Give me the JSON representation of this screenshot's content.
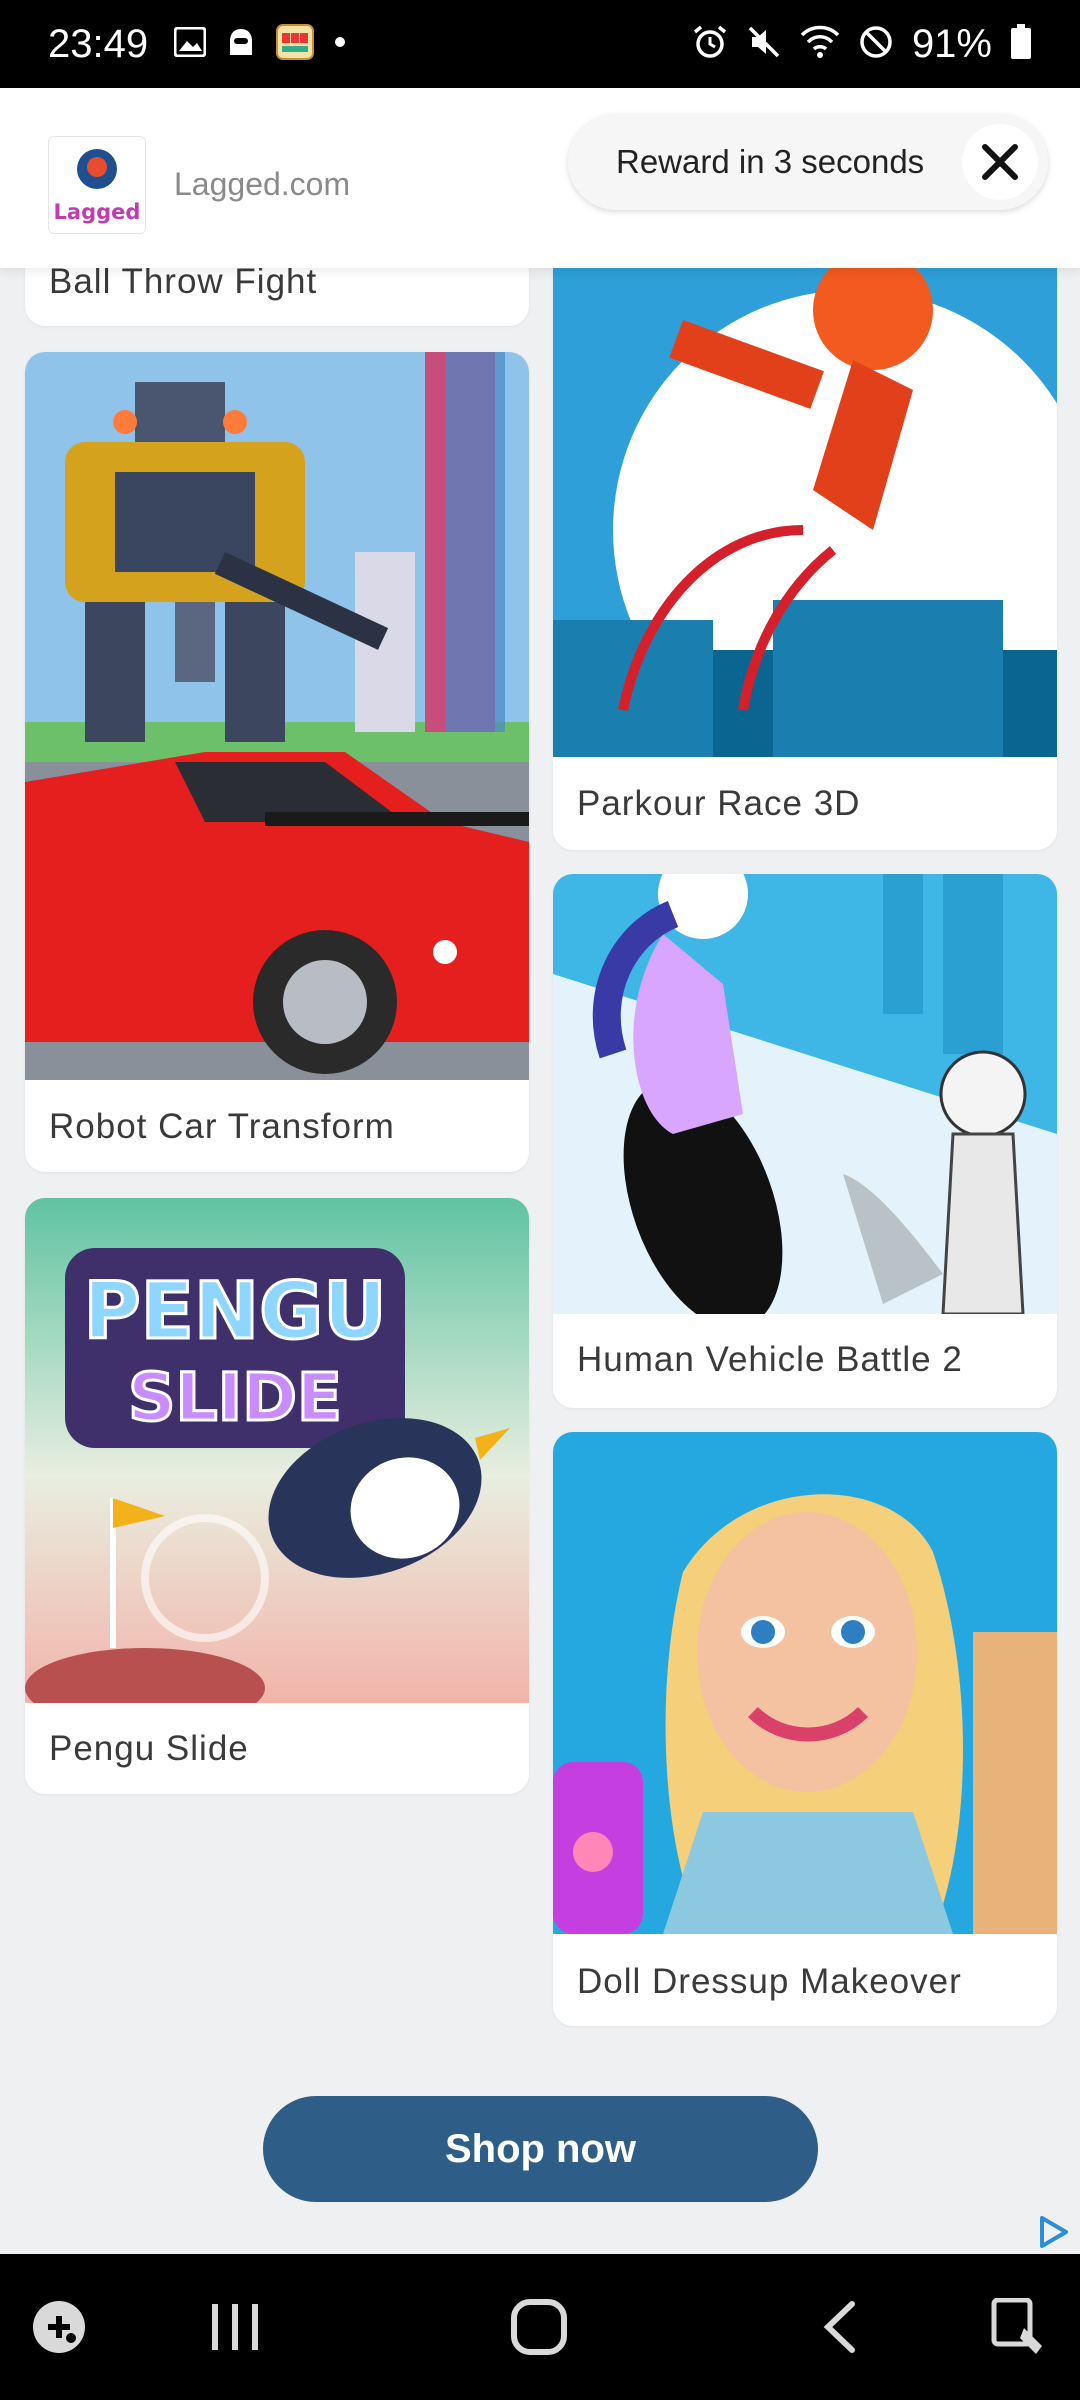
{
  "status_bar": {
    "time": "23:49",
    "battery": "91%",
    "left_icons": [
      "image-icon",
      "ghost-icon",
      "slot-game-icon",
      "dot-icon"
    ],
    "right_icons": [
      "alarm-icon",
      "mute-icon",
      "wifi-icon",
      "do-not-disturb-icon",
      "battery-icon"
    ]
  },
  "ad_header": {
    "logo_text": "Lagged",
    "site": "Lagged.com",
    "reward_text": "Reward in 3 seconds",
    "close_icon": "close-icon"
  },
  "games": [
    {
      "title": "Ball Throw Fight"
    },
    {
      "title": "Robot Car Transform"
    },
    {
      "title": "Pengu Slide"
    },
    {
      "title": "Parkour Race 3D"
    },
    {
      "title": "Human Vehicle Battle 2"
    },
    {
      "title": "Doll Dressup Makeover"
    }
  ],
  "thumb_text": {
    "pengu_line1": "PENGU",
    "pengu_line2": "SLIDE"
  },
  "cta": {
    "label": "Shop now"
  },
  "nav": [
    "game-launcher-icon",
    "recent-apps-icon",
    "home-icon",
    "back-icon",
    "screen-lock-icon"
  ],
  "colors": {
    "cta": "#2e5d87",
    "status_bar": "#000000"
  }
}
